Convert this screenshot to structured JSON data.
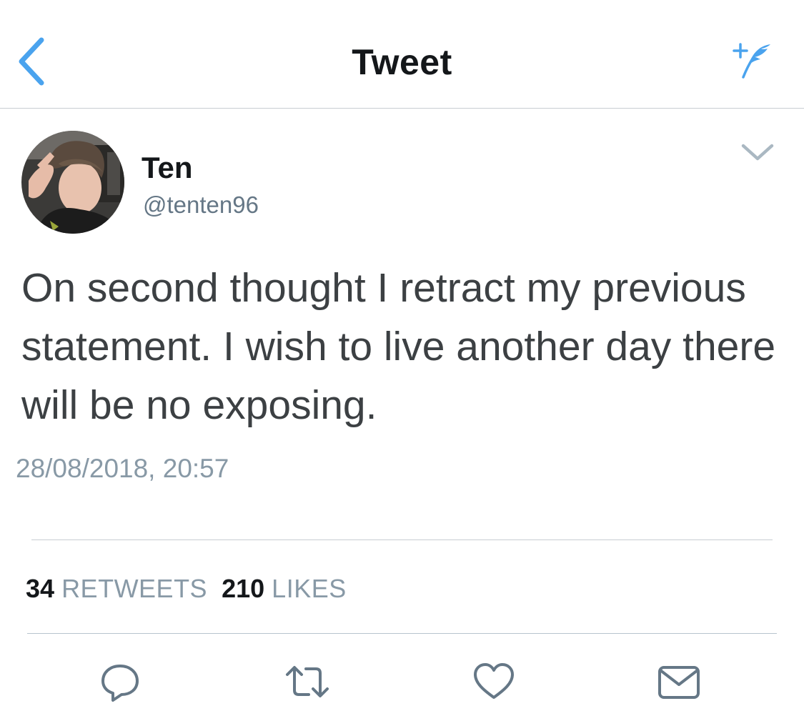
{
  "nav": {
    "title": "Tweet",
    "back_icon": "chevron-left-icon",
    "compose_icon": "compose-feather-icon"
  },
  "tweet": {
    "author": {
      "name": "Ten",
      "handle": "@tenten96"
    },
    "text": "On second thought I retract my previous statement. I wish to live another day there will be no exposing.",
    "timestamp": "28/08/2018, 20:57",
    "stats": {
      "retweets_count": "34",
      "retweets_label": "RETWEETS",
      "likes_count": "210",
      "likes_label": "LIKES"
    }
  },
  "actions": [
    "reply-icon",
    "retweet-icon",
    "like-icon",
    "share-icon"
  ],
  "colors": {
    "accent": "#4aa3ee",
    "icon_gray": "#657786",
    "divider": "#c8cdd2"
  }
}
